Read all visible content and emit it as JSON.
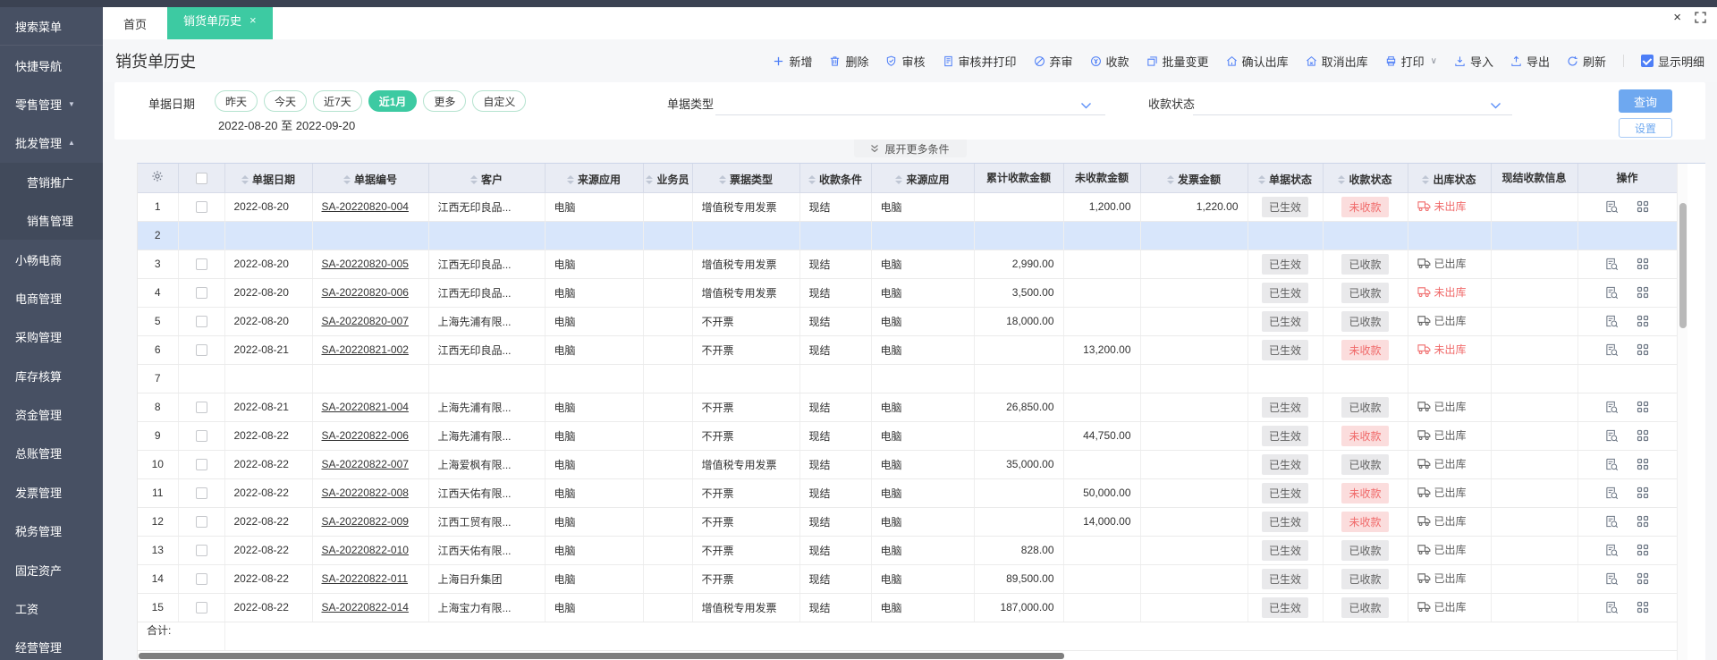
{
  "colors": {
    "accent_green": "#3dcaa2",
    "icon_blue": "#4d7ef7",
    "danger": "#f06a6a",
    "selected_row": "#d8e6fb",
    "totals_bg": "#f9f0d7"
  },
  "sidebar": {
    "items": [
      {
        "label": "搜索菜单"
      },
      {
        "label": "快捷导航"
      },
      {
        "label": "零售管理",
        "caret": "▼"
      },
      {
        "label": "批发管理",
        "caret": "▲"
      },
      {
        "label": "营销推广",
        "sub": true
      },
      {
        "label": "销售管理",
        "sub": true
      },
      {
        "label": "小畅电商"
      },
      {
        "label": "电商管理"
      },
      {
        "label": "采购管理"
      },
      {
        "label": "库存核算"
      },
      {
        "label": "资金管理"
      },
      {
        "label": "总账管理"
      },
      {
        "label": "发票管理"
      },
      {
        "label": "税务管理"
      },
      {
        "label": "固定资产"
      },
      {
        "label": "工资"
      },
      {
        "label": "经营管理"
      }
    ]
  },
  "tabs": {
    "home_label": "首页",
    "active_label": "销货单历史",
    "close_glyph": "×"
  },
  "window": {
    "close_glyph": "×"
  },
  "page": {
    "title": "销货单历史"
  },
  "toolbar": {
    "items": [
      {
        "id": "new",
        "label": "新增"
      },
      {
        "id": "delete",
        "label": "删除"
      },
      {
        "id": "audit",
        "label": "审核"
      },
      {
        "id": "audit-print",
        "label": "审核并打印"
      },
      {
        "id": "discard-audit",
        "label": "弃审"
      },
      {
        "id": "receive-payment",
        "label": "收款"
      },
      {
        "id": "batch-change",
        "label": "批量变更"
      },
      {
        "id": "confirm-outbound",
        "label": "确认出库"
      },
      {
        "id": "cancel-outbound",
        "label": "取消出库"
      },
      {
        "id": "print",
        "label": "打印"
      },
      {
        "id": "import",
        "label": "导入"
      },
      {
        "id": "export",
        "label": "导出"
      },
      {
        "id": "refresh",
        "label": "刷新"
      }
    ],
    "show_detail_label": "显示明细",
    "show_detail_checked": true
  },
  "filters": {
    "date_label": "单据日期",
    "date_pills": [
      {
        "label": "昨天"
      },
      {
        "label": "今天"
      },
      {
        "label": "近7天"
      },
      {
        "label": "近1月",
        "active": true
      },
      {
        "label": "更多"
      },
      {
        "label": "自定义"
      }
    ],
    "date_range": "2022-08-20 至 2022-09-20",
    "type_label": "单据类型",
    "pay_status_label": "收款状态",
    "query_label": "查询",
    "settings_label": "设置",
    "expand_more_label": "展开更多条件"
  },
  "table": {
    "columns": [
      {
        "label": "单据日期",
        "sortable": true
      },
      {
        "label": "单据编号",
        "sortable": true
      },
      {
        "label": "客户",
        "sortable": true
      },
      {
        "label": "来源应用",
        "sortable": true
      },
      {
        "label": "业务员",
        "sortable": true
      },
      {
        "label": "票据类型",
        "sortable": true
      },
      {
        "label": "收款条件",
        "sortable": true
      },
      {
        "label": "来源应用",
        "sortable": true
      },
      {
        "label": "累计收款金额",
        "sortable": false
      },
      {
        "label": "未收款金额",
        "sortable": false
      },
      {
        "label": "发票金额",
        "sortable": true
      },
      {
        "label": "单据状态",
        "sortable": true
      },
      {
        "label": "收款状态",
        "sortable": true
      },
      {
        "label": "出库状态",
        "sortable": true
      },
      {
        "label": "现结收款信息",
        "sortable": false
      },
      {
        "label": "操作",
        "sortable": false
      }
    ],
    "rows": [
      {
        "no": "1",
        "date": "2022-08-20",
        "code": "SA-20220820-004",
        "customer": "江西无印良品...",
        "source": "电脑",
        "salesman": "",
        "invoice_type": "增值税专用发票",
        "terms": "现结",
        "source2": "电脑",
        "received": "",
        "unreceived": "1,200.00",
        "invoice_amount": "1,220.00",
        "cash_info": "",
        "doc_status": {
          "label": "已生效",
          "variant": "default"
        },
        "pay_status": {
          "label": "未收款",
          "variant": "danger"
        },
        "out_status": {
          "label": "未出库",
          "variant": "danger"
        }
      },
      {
        "no": "2",
        "selected": true,
        "empty": true,
        "date": "",
        "code": "",
        "customer": "",
        "source": "",
        "salesman": "",
        "invoice_type": "",
        "terms": "",
        "source2": "",
        "received": "",
        "unreceived": "",
        "invoice_amount": "",
        "cash_info": ""
      },
      {
        "no": "3",
        "date": "2022-08-20",
        "code": "SA-20220820-005",
        "customer": "江西无印良品...",
        "source": "电脑",
        "salesman": "",
        "invoice_type": "增值税专用发票",
        "terms": "现结",
        "source2": "电脑",
        "received": "2,990.00",
        "unreceived": "",
        "invoice_amount": "",
        "cash_info": "",
        "doc_status": {
          "label": "已生效",
          "variant": "default"
        },
        "pay_status": {
          "label": "已收款",
          "variant": "default"
        },
        "out_status": {
          "label": "已出库",
          "variant": "default"
        }
      },
      {
        "no": "4",
        "date": "2022-08-20",
        "code": "SA-20220820-006",
        "customer": "江西无印良品...",
        "source": "电脑",
        "salesman": "",
        "invoice_type": "增值税专用发票",
        "terms": "现结",
        "source2": "电脑",
        "received": "3,500.00",
        "unreceived": "",
        "invoice_amount": "",
        "cash_info": "",
        "doc_status": {
          "label": "已生效",
          "variant": "default"
        },
        "pay_status": {
          "label": "已收款",
          "variant": "default"
        },
        "out_status": {
          "label": "未出库",
          "variant": "danger"
        }
      },
      {
        "no": "5",
        "date": "2022-08-20",
        "code": "SA-20220820-007",
        "customer": "上海先浦有限...",
        "source": "电脑",
        "salesman": "",
        "invoice_type": "不开票",
        "terms": "现结",
        "source2": "电脑",
        "received": "18,000.00",
        "unreceived": "",
        "invoice_amount": "",
        "cash_info": "",
        "doc_status": {
          "label": "已生效",
          "variant": "default"
        },
        "pay_status": {
          "label": "已收款",
          "variant": "default"
        },
        "out_status": {
          "label": "已出库",
          "variant": "default"
        }
      },
      {
        "no": "6",
        "date": "2022-08-21",
        "code": "SA-20220821-002",
        "customer": "江西无印良品...",
        "source": "电脑",
        "salesman": "",
        "invoice_type": "不开票",
        "terms": "现结",
        "source2": "电脑",
        "received": "",
        "unreceived": "13,200.00",
        "invoice_amount": "",
        "cash_info": "",
        "doc_status": {
          "label": "已生效",
          "variant": "default"
        },
        "pay_status": {
          "label": "未收款",
          "variant": "danger"
        },
        "out_status": {
          "label": "未出库",
          "variant": "danger"
        }
      },
      {
        "no": "7",
        "empty": true,
        "date": "",
        "code": "",
        "customer": "",
        "source": "",
        "salesman": "",
        "invoice_type": "",
        "terms": "",
        "source2": "",
        "received": "",
        "unreceived": "",
        "invoice_amount": "",
        "cash_info": ""
      },
      {
        "no": "8",
        "date": "2022-08-21",
        "code": "SA-20220821-004",
        "customer": "上海先浦有限...",
        "source": "电脑",
        "salesman": "",
        "invoice_type": "不开票",
        "terms": "现结",
        "source2": "电脑",
        "received": "26,850.00",
        "unreceived": "",
        "invoice_amount": "",
        "cash_info": "",
        "doc_status": {
          "label": "已生效",
          "variant": "default"
        },
        "pay_status": {
          "label": "已收款",
          "variant": "default"
        },
        "out_status": {
          "label": "已出库",
          "variant": "default"
        }
      },
      {
        "no": "9",
        "date": "2022-08-22",
        "code": "SA-20220822-006",
        "customer": "上海先浦有限...",
        "source": "电脑",
        "salesman": "",
        "invoice_type": "不开票",
        "terms": "现结",
        "source2": "电脑",
        "received": "",
        "unreceived": "44,750.00",
        "invoice_amount": "",
        "cash_info": "",
        "doc_status": {
          "label": "已生效",
          "variant": "default"
        },
        "pay_status": {
          "label": "未收款",
          "variant": "danger"
        },
        "out_status": {
          "label": "已出库",
          "variant": "default"
        }
      },
      {
        "no": "10",
        "date": "2022-08-22",
        "code": "SA-20220822-007",
        "customer": "上海爱枫有限...",
        "source": "电脑",
        "salesman": "",
        "invoice_type": "增值税专用发票",
        "terms": "现结",
        "source2": "电脑",
        "received": "35,000.00",
        "unreceived": "",
        "invoice_amount": "",
        "cash_info": "",
        "doc_status": {
          "label": "已生效",
          "variant": "default"
        },
        "pay_status": {
          "label": "已收款",
          "variant": "default"
        },
        "out_status": {
          "label": "已出库",
          "variant": "default"
        }
      },
      {
        "no": "11",
        "date": "2022-08-22",
        "code": "SA-20220822-008",
        "customer": "江西天佑有限...",
        "source": "电脑",
        "salesman": "",
        "invoice_type": "不开票",
        "terms": "现结",
        "source2": "电脑",
        "received": "",
        "unreceived": "50,000.00",
        "invoice_amount": "",
        "cash_info": "",
        "doc_status": {
          "label": "已生效",
          "variant": "default"
        },
        "pay_status": {
          "label": "未收款",
          "variant": "danger"
        },
        "out_status": {
          "label": "已出库",
          "variant": "default"
        }
      },
      {
        "no": "12",
        "date": "2022-08-22",
        "code": "SA-20220822-009",
        "customer": "江西工贸有限...",
        "source": "电脑",
        "salesman": "",
        "invoice_type": "不开票",
        "terms": "现结",
        "source2": "电脑",
        "received": "",
        "unreceived": "14,000.00",
        "invoice_amount": "",
        "cash_info": "",
        "doc_status": {
          "label": "已生效",
          "variant": "default"
        },
        "pay_status": {
          "label": "未收款",
          "variant": "danger"
        },
        "out_status": {
          "label": "已出库",
          "variant": "default"
        }
      },
      {
        "no": "13",
        "date": "2022-08-22",
        "code": "SA-20220822-010",
        "customer": "江西天佑有限...",
        "source": "电脑",
        "salesman": "",
        "invoice_type": "不开票",
        "terms": "现结",
        "source2": "电脑",
        "received": "828.00",
        "unreceived": "",
        "invoice_amount": "",
        "cash_info": "",
        "doc_status": {
          "label": "已生效",
          "variant": "default"
        },
        "pay_status": {
          "label": "已收款",
          "variant": "default"
        },
        "out_status": {
          "label": "已出库",
          "variant": "default"
        }
      },
      {
        "no": "14",
        "date": "2022-08-22",
        "code": "SA-20220822-011",
        "customer": "上海日升集团",
        "source": "电脑",
        "salesman": "",
        "invoice_type": "不开票",
        "terms": "现结",
        "source2": "电脑",
        "received": "89,500.00",
        "unreceived": "",
        "invoice_amount": "",
        "cash_info": "",
        "doc_status": {
          "label": "已生效",
          "variant": "default"
        },
        "pay_status": {
          "label": "已收款",
          "variant": "default"
        },
        "out_status": {
          "label": "已出库",
          "variant": "default"
        }
      },
      {
        "no": "15",
        "date": "2022-08-22",
        "code": "SA-20220822-014",
        "customer": "上海宝力有限...",
        "source": "电脑",
        "salesman": "",
        "invoice_type": "增值税专用发票",
        "terms": "现结",
        "source2": "电脑",
        "received": "187,000.00",
        "unreceived": "",
        "invoice_amount": "",
        "cash_info": "",
        "doc_status": {
          "label": "已生效",
          "variant": "default"
        },
        "pay_status": {
          "label": "已收款",
          "variant": "default"
        },
        "out_status": {
          "label": "已出库",
          "variant": "default"
        }
      }
    ],
    "footer_label": "合计:"
  }
}
